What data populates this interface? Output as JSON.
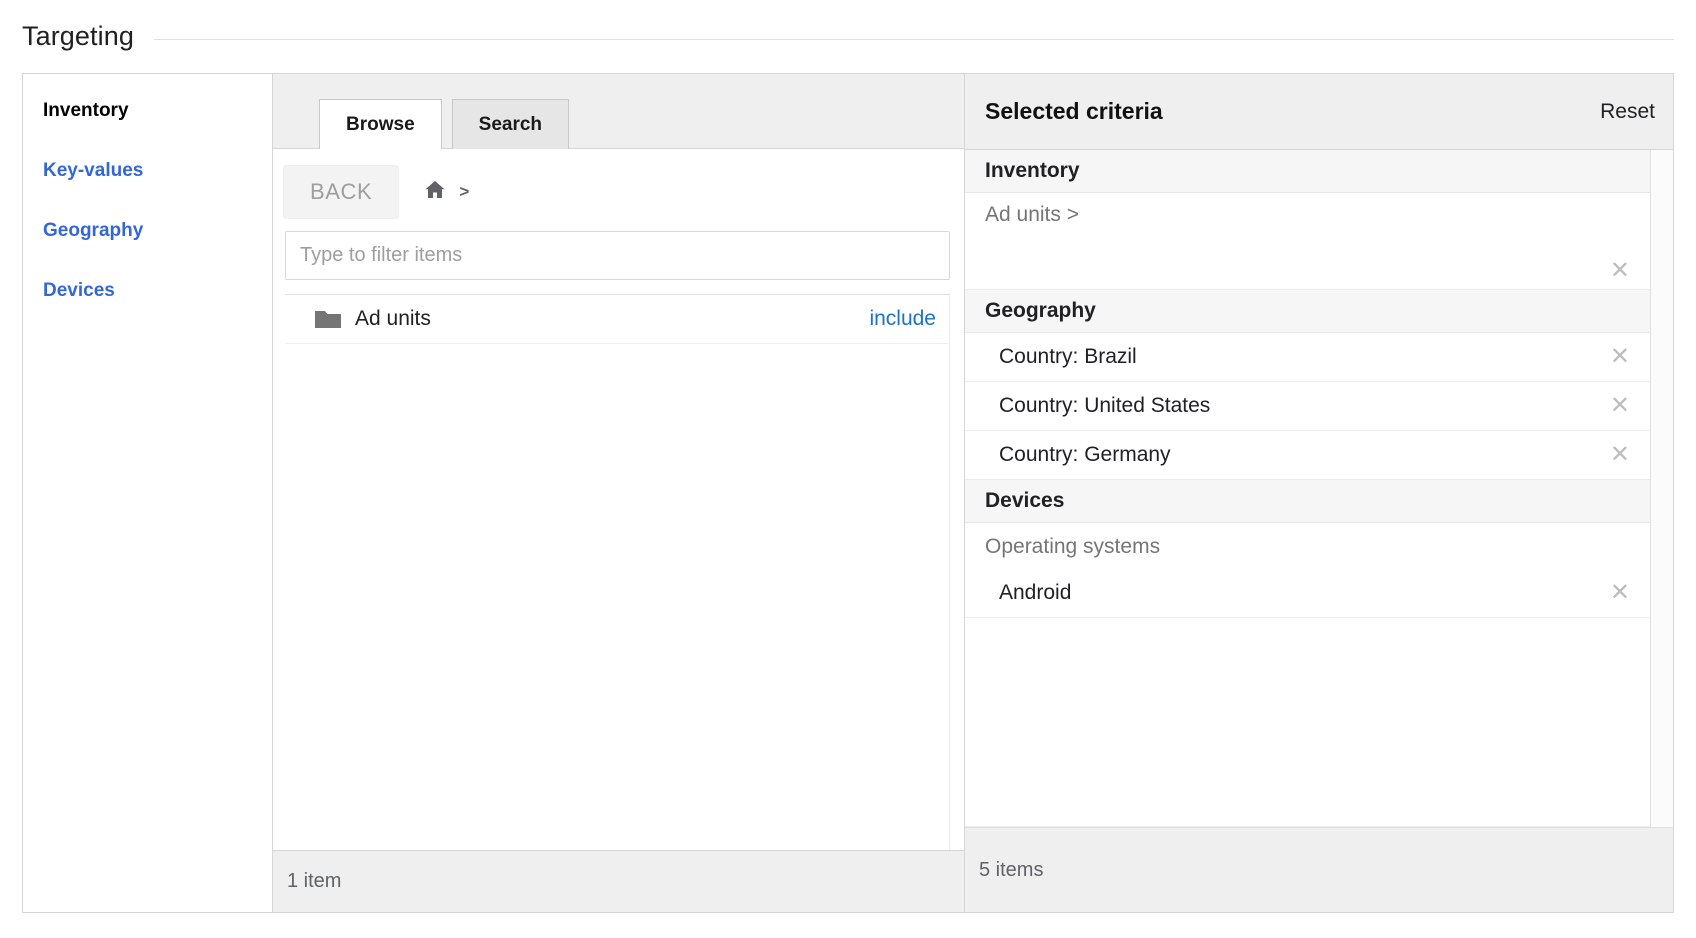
{
  "page": {
    "title": "Targeting"
  },
  "sidebar": {
    "items": [
      {
        "label": "Inventory",
        "active": true
      },
      {
        "label": "Key-values",
        "active": false
      },
      {
        "label": "Geography",
        "active": false
      },
      {
        "label": "Devices",
        "active": false
      }
    ]
  },
  "browse": {
    "tabs": [
      {
        "label": "Browse",
        "active": true
      },
      {
        "label": "Search",
        "active": false
      }
    ],
    "back_label": "BACK",
    "breadcrumb": {
      "home_icon": "home-icon",
      "separator": ">"
    },
    "filter": {
      "value": "",
      "placeholder": "Type to filter items"
    },
    "rows": [
      {
        "icon": "folder-icon",
        "label": "Ad units",
        "action": "include"
      }
    ],
    "footer": "1 item"
  },
  "selected": {
    "title": "Selected criteria",
    "reset_label": "Reset",
    "remove_icon": "close-icon",
    "groups": [
      {
        "header": "Inventory",
        "sub_label": null,
        "rows": [
          {
            "label": "Ad units >",
            "muted": true,
            "tall": true,
            "indent": false,
            "removable": true
          }
        ]
      },
      {
        "header": "Geography",
        "sub_label": null,
        "rows": [
          {
            "label": "Country: Brazil",
            "muted": false,
            "tall": false,
            "indent": true,
            "removable": true
          },
          {
            "label": "Country: United States",
            "muted": false,
            "tall": false,
            "indent": true,
            "removable": true
          },
          {
            "label": "Country: Germany",
            "muted": false,
            "tall": false,
            "indent": true,
            "removable": true
          }
        ]
      },
      {
        "header": "Devices",
        "sub_label": "Operating systems",
        "rows": [
          {
            "label": "Android",
            "muted": false,
            "tall": false,
            "indent": true,
            "removable": true
          }
        ]
      }
    ],
    "footer": "5 items"
  },
  "colors": {
    "link_blue": "#3367d6",
    "include_blue": "#1a73c8",
    "panel_gray": "#efefef",
    "border_gray": "#d6d6d6"
  }
}
